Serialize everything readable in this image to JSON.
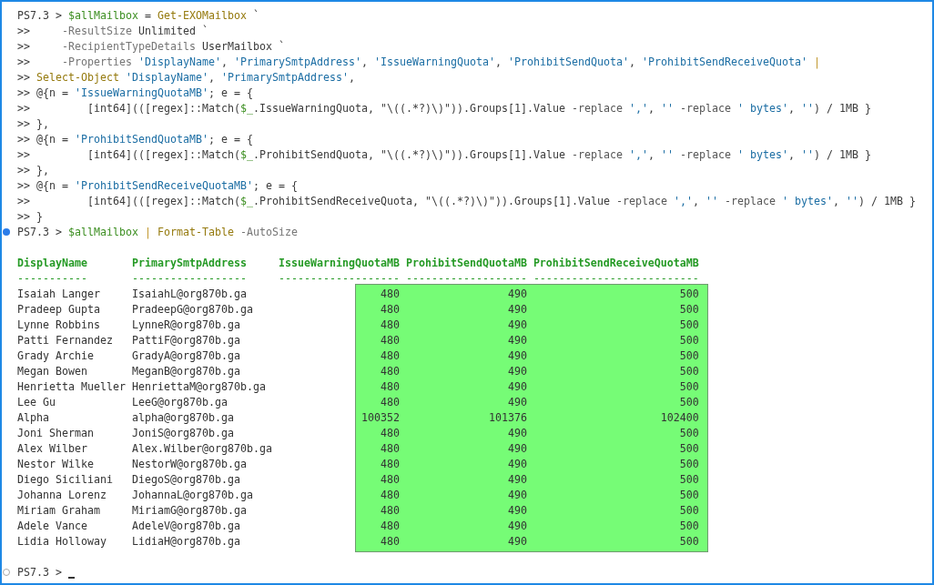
{
  "terminal": {
    "commands": [
      {
        "kind": "plain",
        "cursor": false,
        "lines": [
          {
            "prompt": "PS7.3 >",
            "code": [
              {
                "kind": "variable",
                "text": "$allMailbox"
              },
              {
                "kind": "plain",
                "text": " = "
              },
              {
                "kind": "command",
                "text": "Get-EXOMailbox"
              },
              {
                "kind": "plain",
                "text": " `"
              }
            ]
          },
          {
            "prompt": ">>",
            "code": [
              {
                "kind": "parameter",
                "text": "    -ResultSize"
              },
              {
                "kind": "plain",
                "text": " Unlimited `"
              }
            ]
          },
          {
            "prompt": ">>",
            "code": [
              {
                "kind": "parameter",
                "text": "    -RecipientTypeDetails"
              },
              {
                "kind": "plain",
                "text": " UserMailbox `"
              }
            ]
          },
          {
            "prompt": ">>",
            "code": [
              {
                "kind": "parameter",
                "text": "    -Properties "
              },
              {
                "kind": "string",
                "text": "'DisplayName'"
              },
              {
                "kind": "plain",
                "text": ", "
              },
              {
                "kind": "string",
                "text": "'PrimarySmtpAddress'"
              },
              {
                "kind": "plain",
                "text": ", "
              },
              {
                "kind": "string",
                "text": "'IssueWarningQuota'"
              },
              {
                "kind": "plain",
                "text": ", "
              },
              {
                "kind": "string",
                "text": "'ProhibitSendQuota'"
              },
              {
                "kind": "plain",
                "text": ", "
              },
              {
                "kind": "string",
                "text": "'ProhibitSendReceiveQuota'"
              },
              {
                "kind": "pipe",
                "text": " |"
              }
            ]
          },
          {
            "prompt": ">>",
            "code": [
              {
                "kind": "command",
                "text": "Select-Object "
              },
              {
                "kind": "string",
                "text": "'DisplayName'"
              },
              {
                "kind": "plain",
                "text": ", "
              },
              {
                "kind": "string",
                "text": "'PrimarySmtpAddress'"
              },
              {
                "kind": "plain",
                "text": ","
              }
            ]
          },
          {
            "prompt": ">>",
            "code": [
              {
                "kind": "plain",
                "text": "@{n = "
              },
              {
                "kind": "string",
                "text": "'IssueWarningQuotaMB'"
              },
              {
                "kind": "plain",
                "text": "; e = {"
              }
            ]
          },
          {
            "prompt": ">>",
            "code": [
              {
                "kind": "plain",
                "text": "        [int64](([regex]::Match("
              },
              {
                "kind": "variable",
                "text": "$_"
              },
              {
                "kind": "plain",
                "text": ".IssueWarningQuota, \"\\((.*?)\\)\")).Groups[1].Value "
              },
              {
                "kind": "operator",
                "text": "-replace "
              },
              {
                "kind": "string",
                "text": "','"
              },
              {
                "kind": "plain",
                "text": ", "
              },
              {
                "kind": "string",
                "text": "''"
              },
              {
                "kind": "operator",
                "text": " -replace "
              },
              {
                "kind": "string",
                "text": "' bytes'"
              },
              {
                "kind": "plain",
                "text": ", "
              },
              {
                "kind": "string",
                "text": "''"
              },
              {
                "kind": "plain",
                "text": ") / 1MB }"
              }
            ]
          },
          {
            "prompt": ">>",
            "code": [
              {
                "kind": "plain",
                "text": "},"
              }
            ]
          },
          {
            "prompt": ">>",
            "code": [
              {
                "kind": "plain",
                "text": "@{n = "
              },
              {
                "kind": "string",
                "text": "'ProhibitSendQuotaMB'"
              },
              {
                "kind": "plain",
                "text": "; e = {"
              }
            ]
          },
          {
            "prompt": ">>",
            "code": [
              {
                "kind": "plain",
                "text": "        [int64](([regex]::Match("
              },
              {
                "kind": "variable",
                "text": "$_"
              },
              {
                "kind": "plain",
                "text": ".ProhibitSendQuota, \"\\((.*?)\\)\")).Groups[1].Value "
              },
              {
                "kind": "operator",
                "text": "-replace "
              },
              {
                "kind": "string",
                "text": "','"
              },
              {
                "kind": "plain",
                "text": ", "
              },
              {
                "kind": "string",
                "text": "''"
              },
              {
                "kind": "operator",
                "text": " -replace "
              },
              {
                "kind": "string",
                "text": "' bytes'"
              },
              {
                "kind": "plain",
                "text": ", "
              },
              {
                "kind": "string",
                "text": "''"
              },
              {
                "kind": "plain",
                "text": ") / 1MB }"
              }
            ]
          },
          {
            "prompt": ">>",
            "code": [
              {
                "kind": "plain",
                "text": "},"
              }
            ]
          },
          {
            "prompt": ">>",
            "code": [
              {
                "kind": "plain",
                "text": "@{n = "
              },
              {
                "kind": "string",
                "text": "'ProhibitSendReceiveQuotaMB'"
              },
              {
                "kind": "plain",
                "text": "; e = {"
              }
            ]
          },
          {
            "prompt": ">>",
            "code": [
              {
                "kind": "plain",
                "text": "        [int64](([regex]::Match("
              },
              {
                "kind": "variable",
                "text": "$_"
              },
              {
                "kind": "plain",
                "text": ".ProhibitSendReceiveQuota, \"\\((.*?)\\)\")).Groups[1].Value "
              },
              {
                "kind": "operator",
                "text": "-replace "
              },
              {
                "kind": "string",
                "text": "','"
              },
              {
                "kind": "plain",
                "text": ", "
              },
              {
                "kind": "string",
                "text": "''"
              },
              {
                "kind": "operator",
                "text": " -replace "
              },
              {
                "kind": "string",
                "text": "' bytes'"
              },
              {
                "kind": "plain",
                "text": ", "
              },
              {
                "kind": "string",
                "text": "''"
              },
              {
                "kind": "plain",
                "text": ") / 1MB }"
              }
            ]
          },
          {
            "prompt": ">>",
            "code": [
              {
                "kind": "plain",
                "text": "}"
              }
            ]
          }
        ]
      },
      {
        "kind": "success",
        "cursor": false,
        "lines": [
          {
            "prompt": "PS7.3 >",
            "code": [
              {
                "kind": "variable",
                "text": "$allMailbox"
              },
              {
                "kind": "pipe",
                "text": " | "
              },
              {
                "kind": "command",
                "text": "Format-Table "
              },
              {
                "kind": "parameter",
                "text": "-AutoSize"
              }
            ]
          }
        ],
        "output": {
          "columns": [
            {
              "name": "DisplayName",
              "rule": "-----------",
              "kind": "text",
              "highlighted": false
            },
            {
              "name": "PrimarySmtpAddress",
              "rule": "------------------",
              "kind": "text",
              "highlighted": false
            },
            {
              "name": "IssueWarningQuotaMB",
              "rule": "-------------------",
              "kind": "number",
              "highlighted": true
            },
            {
              "name": "ProhibitSendQuotaMB",
              "rule": "-------------------",
              "kind": "number",
              "highlighted": true
            },
            {
              "name": "ProhibitSendReceiveQuotaMB",
              "rule": "--------------------------",
              "kind": "number",
              "highlighted": true
            }
          ],
          "rows": [
            [
              "Isaiah Langer",
              "IsaiahL@org870b.ga",
              "480",
              "490",
              "500"
            ],
            [
              "Pradeep Gupta",
              "PradeepG@org870b.ga",
              "480",
              "490",
              "500"
            ],
            [
              "Lynne Robbins",
              "LynneR@org870b.ga",
              "480",
              "490",
              "500"
            ],
            [
              "Patti Fernandez",
              "PattiF@org870b.ga",
              "480",
              "490",
              "500"
            ],
            [
              "Grady Archie",
              "GradyA@org870b.ga",
              "480",
              "490",
              "500"
            ],
            [
              "Megan Bowen",
              "MeganB@org870b.ga",
              "480",
              "490",
              "500"
            ],
            [
              "Henrietta Mueller",
              "HenriettaM@org870b.ga",
              "480",
              "490",
              "500"
            ],
            [
              "Lee Gu",
              "LeeG@org870b.ga",
              "480",
              "490",
              "500"
            ],
            [
              "Alpha",
              "alpha@org870b.ga",
              "100352",
              "101376",
              "102400"
            ],
            [
              "Joni Sherman",
              "JoniS@org870b.ga",
              "480",
              "490",
              "500"
            ],
            [
              "Alex Wilber",
              "Alex.Wilber@org870b.ga",
              "480",
              "490",
              "500"
            ],
            [
              "Nestor Wilke",
              "NestorW@org870b.ga",
              "480",
              "490",
              "500"
            ],
            [
              "Diego Siciliani",
              "DiegoS@org870b.ga",
              "480",
              "490",
              "500"
            ],
            [
              "Johanna Lorenz",
              "JohannaL@org870b.ga",
              "480",
              "490",
              "500"
            ],
            [
              "Miriam Graham",
              "MiriamG@org870b.ga",
              "480",
              "490",
              "500"
            ],
            [
              "Adele Vance",
              "AdeleV@org870b.ga",
              "480",
              "490",
              "500"
            ],
            [
              "Lidia Holloway",
              "LidiaH@org870b.ga",
              "480",
              "490",
              "500"
            ]
          ]
        }
      },
      {
        "kind": "pending",
        "cursor": true,
        "lines": [
          {
            "prompt": "PS7.3 >"
          }
        ]
      }
    ]
  }
}
